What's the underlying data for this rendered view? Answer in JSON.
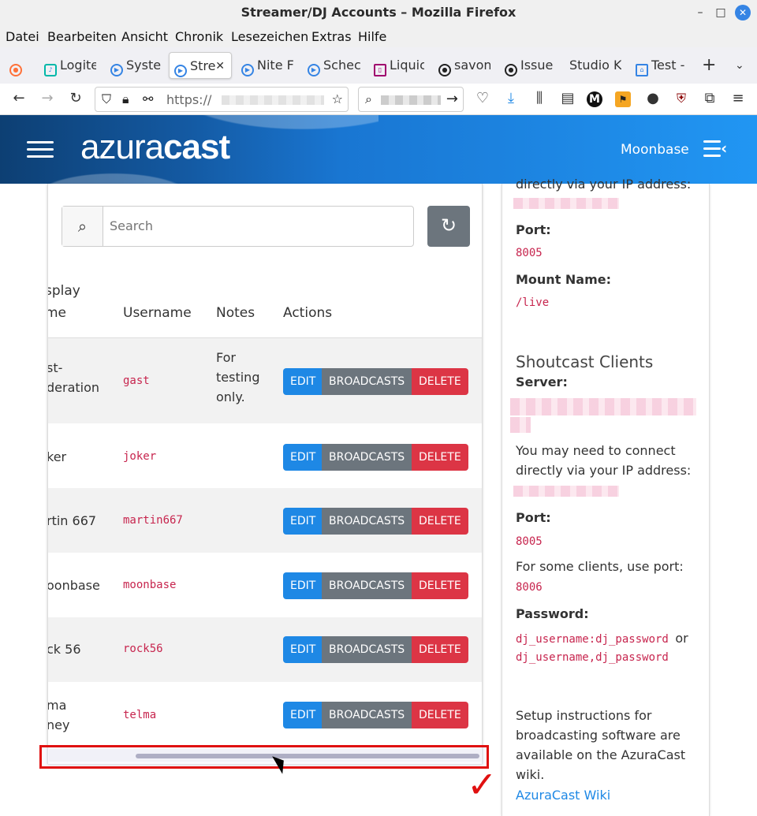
{
  "window": {
    "title": "Streamer/DJ Accounts – Mozilla Firefox"
  },
  "menu": [
    "Datei",
    "Bearbeiten",
    "Ansicht",
    "Chronik",
    "Lesezeichen",
    "Extras",
    "Hilfe"
  ],
  "tabs": [
    {
      "label": "Logite"
    },
    {
      "label": "Syste"
    },
    {
      "label": "Stre"
    },
    {
      "label": "Nite F"
    },
    {
      "label": "Schec"
    },
    {
      "label": "Liquic"
    },
    {
      "label": "savon"
    },
    {
      "label": "Issue"
    },
    {
      "label": "Studio K"
    },
    {
      "label": "Test -"
    }
  ],
  "nav": {
    "url": "https://"
  },
  "header": {
    "logo_light": "azura",
    "logo_bold": "cast",
    "station": "Moonbase"
  },
  "table": {
    "search_placeholder": "Search",
    "headers": {
      "display_line1": "splay",
      "display_line2": "me",
      "username": "Username",
      "notes": "Notes",
      "actions": "Actions"
    },
    "buttons": {
      "edit": "EDIT",
      "broadcasts": "BROADCASTS",
      "delete": "DELETE"
    },
    "rows": [
      {
        "display_line1": "st-",
        "display_line2": "deration",
        "username": "gast",
        "notes_line1": "For",
        "notes_line2": "testing",
        "notes_line3": "only."
      },
      {
        "display_line1": "ker",
        "display_line2": "",
        "username": "joker",
        "notes_line1": "",
        "notes_line2": "",
        "notes_line3": ""
      },
      {
        "display_line1": "rtin 667",
        "display_line2": "",
        "username": "martin667",
        "notes_line1": "",
        "notes_line2": "",
        "notes_line3": ""
      },
      {
        "display_line1": "oonbase",
        "display_line2": "",
        "username": "moonbase",
        "notes_line1": "",
        "notes_line2": "",
        "notes_line3": ""
      },
      {
        "display_line1": "ck 56",
        "display_line2": "",
        "username": "rock56",
        "notes_line1": "",
        "notes_line2": "",
        "notes_line3": ""
      },
      {
        "display_line1": "ma",
        "display_line2": "ney",
        "username": "telma",
        "notes_line1": "",
        "notes_line2": "",
        "notes_line3": ""
      }
    ]
  },
  "sidebar": {
    "ip_note_top": "directly via your IP address:",
    "port_label": "Port:",
    "port_value": "8005",
    "mount_label": "Mount Name:",
    "mount_value": "/live",
    "shoutcast_heading": "Shoutcast Clients",
    "server_label": "Server:",
    "ip_note_line1": "You may need to connect",
    "ip_note_line2": "directly via your IP address:",
    "port2_label": "Port:",
    "port2_value": "8005",
    "alt_port_note": "For some clients, use port:",
    "alt_port_value": "8006",
    "password_label": "Password:",
    "password_value1": "dj_username:dj_password",
    "password_or": "or",
    "password_value2": "dj_username,dj_password",
    "setup_line1": "Setup instructions for",
    "setup_line2": "broadcasting software are",
    "setup_line3": "available on the AzuraCast",
    "setup_line4": "wiki.",
    "wiki_link": "AzuraCast Wiki"
  },
  "colors": {
    "accent": "#1e88e5",
    "danger": "#dc3545",
    "secondary": "#6c757d",
    "code": "#c7254e",
    "annotation": "#e01010"
  }
}
